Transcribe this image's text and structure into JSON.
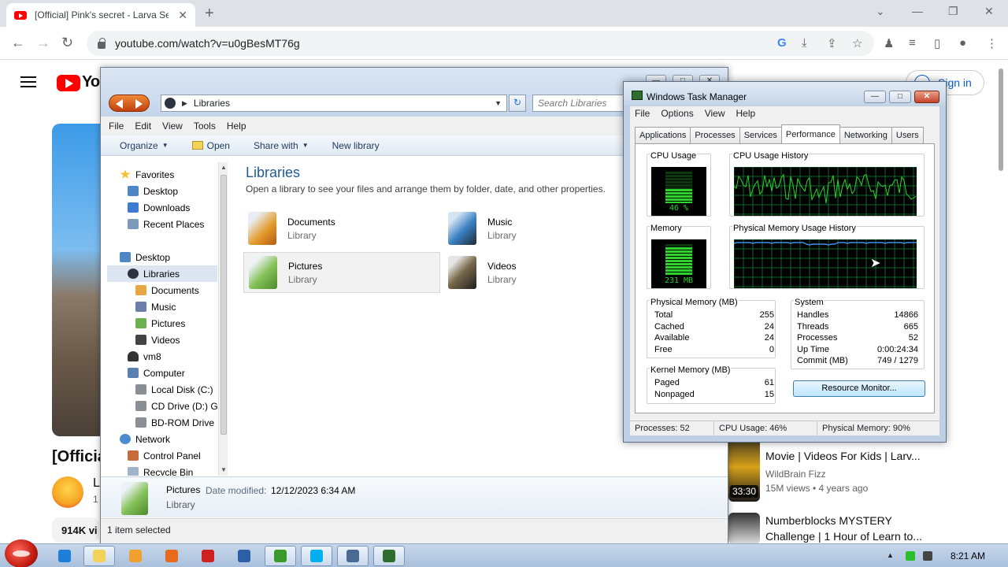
{
  "browser": {
    "tab_title": "[Official] Pink's secret - Larva Se",
    "tab_close": "✕",
    "new_tab": "+",
    "url": "youtube.com/watch?v=u0gBesMT76g",
    "window_controls": [
      "⌄",
      "—",
      "❐",
      "✕"
    ]
  },
  "youtube": {
    "logo_text": "Yo",
    "sign_in": "Sign in",
    "video_title": "[Officia",
    "channel_initial": "L",
    "channel_sub": "1",
    "stats": "914K vi",
    "recommendations": [
      {
        "title": "Movie | Videos For Kids | Larv...",
        "channel": "WildBrain Fizz",
        "meta": "15M views • 4 years ago",
        "duration": "33:30"
      },
      {
        "title_line1": "Numberblocks MYSTERY",
        "title_line2": "Challenge | 1 Hour of Learn to..."
      }
    ]
  },
  "explorer": {
    "address": "Libraries",
    "search_placeholder": "Search Libraries",
    "menu": [
      "File",
      "Edit",
      "View",
      "Tools",
      "Help"
    ],
    "commands": {
      "organize": "Organize",
      "open": "Open",
      "share_with": "Share with",
      "new_library": "New library"
    },
    "nav": [
      {
        "label": "Favorites",
        "icon": "star-icon"
      },
      {
        "label": "Desktop",
        "icon": "desktop-icon"
      },
      {
        "label": "Downloads",
        "icon": "downloads-icon"
      },
      {
        "label": "Recent Places",
        "icon": "recent-places-icon"
      },
      {
        "label": "Desktop",
        "icon": "desktop-icon"
      },
      {
        "label": "Libraries",
        "icon": "libraries-icon"
      },
      {
        "label": "Documents",
        "icon": "documents-icon"
      },
      {
        "label": "Music",
        "icon": "music-icon"
      },
      {
        "label": "Pictures",
        "icon": "pictures-icon"
      },
      {
        "label": "Videos",
        "icon": "videos-icon"
      },
      {
        "label": "vm8",
        "icon": "user-icon"
      },
      {
        "label": "Computer",
        "icon": "computer-icon"
      },
      {
        "label": "Local Disk (C:)",
        "icon": "disk-icon"
      },
      {
        "label": "CD Drive (D:) G",
        "icon": "cd-drive-icon"
      },
      {
        "label": "BD-ROM Drive",
        "icon": "bd-drive-icon"
      },
      {
        "label": "Network",
        "icon": "network-icon"
      },
      {
        "label": "Control Panel",
        "icon": "control-panel-icon"
      },
      {
        "label": "Recycle Bin",
        "icon": "recycle-bin-icon"
      }
    ],
    "content_title": "Libraries",
    "content_subtitle": "Open a library to see your files and arrange them by folder, date, and other properties.",
    "libraries": [
      {
        "name": "Documents",
        "type": "Library"
      },
      {
        "name": "Music",
        "type": "Library"
      },
      {
        "name": "Pictures",
        "type": "Library"
      },
      {
        "name": "Videos",
        "type": "Library"
      }
    ],
    "details": {
      "name": "Pictures",
      "type": "Library",
      "date_label": "Date modified:",
      "date_value": "12/12/2023 6:34 AM"
    },
    "status": "1 item selected"
  },
  "taskmgr": {
    "title": "Windows Task Manager",
    "menu": [
      "File",
      "Options",
      "View",
      "Help"
    ],
    "tabs": [
      "Applications",
      "Processes",
      "Services",
      "Performance",
      "Networking",
      "Users"
    ],
    "active_tab": "Performance",
    "cpu_usage_label": "CPU Usage",
    "cpu_history_label": "CPU Usage History",
    "cpu_percent_text": "46 %",
    "cpu_fraction": 0.46,
    "memory_label": "Memory",
    "memory_history_label": "Physical Memory Usage History",
    "memory_text": "231 MB",
    "memory_fraction": 0.9,
    "physical_memory": {
      "title": "Physical Memory (MB)",
      "rows": [
        {
          "label": "Total",
          "value": "255"
        },
        {
          "label": "Cached",
          "value": "24"
        },
        {
          "label": "Available",
          "value": "24"
        },
        {
          "label": "Free",
          "value": "0"
        }
      ]
    },
    "kernel_memory": {
      "title": "Kernel Memory (MB)",
      "rows": [
        {
          "label": "Paged",
          "value": "61"
        },
        {
          "label": "Nonpaged",
          "value": "15"
        }
      ]
    },
    "system": {
      "title": "System",
      "rows": [
        {
          "label": "Handles",
          "value": "14866"
        },
        {
          "label": "Threads",
          "value": "665"
        },
        {
          "label": "Processes",
          "value": "52"
        },
        {
          "label": "Up Time",
          "value": "0:00:24:34"
        },
        {
          "label": "Commit (MB)",
          "value": "749 / 1279"
        }
      ]
    },
    "resource_monitor": "Resource Monitor...",
    "status": {
      "processes": "Processes: 52",
      "cpu": "CPU Usage: 46%",
      "memory": "Physical Memory: 90%"
    }
  },
  "taskbar": {
    "clock": "8:21 AM",
    "colors": {
      "ie": "#1e7fd8",
      "explorer": "#f2d35a",
      "media": "#f0a030",
      "firefox": "#e86a1c",
      "opera": "#d01f1f",
      "app": "#2c5fa8",
      "utorrent": "#3a9a2a",
      "skype": "#00aff0",
      "steam": "#4a6a94",
      "taskmgr": "#2e6d2e"
    }
  }
}
